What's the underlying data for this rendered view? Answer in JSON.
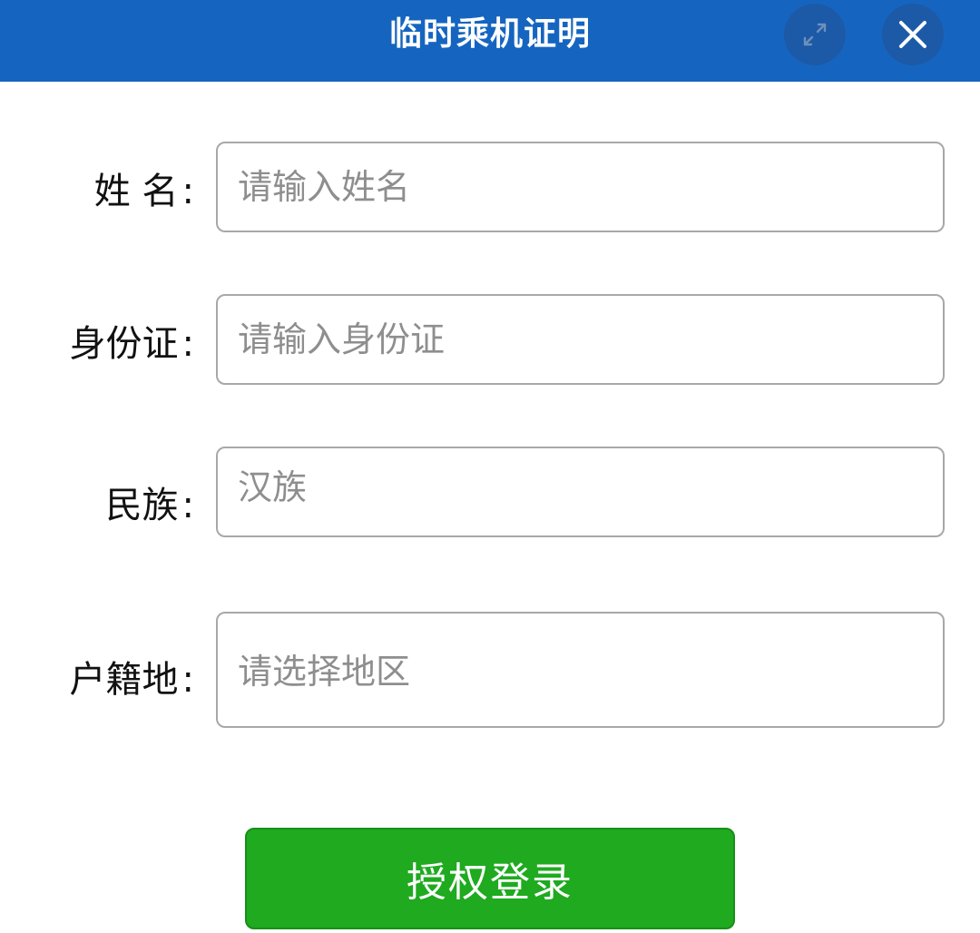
{
  "window": {
    "title": "临时乘机证明",
    "expand_icon": "expand-arrows-icon",
    "close_icon": "close-icon"
  },
  "form": {
    "name": {
      "label": "姓 名",
      "colon": ":",
      "placeholder": "请输入姓名"
    },
    "id_card": {
      "label": "身份证",
      "colon": ":",
      "placeholder": "请输入身份证"
    },
    "ethnicity": {
      "label": "民族",
      "colon": ":",
      "placeholder": "汉族"
    },
    "hometown": {
      "label": "户籍地",
      "colon": ":",
      "placeholder": "请选择地区"
    }
  },
  "submit": {
    "label": "授权登录"
  },
  "colors": {
    "titlebar": "#1565c0",
    "button": "#1faa20",
    "border": "#a8a8a8"
  }
}
